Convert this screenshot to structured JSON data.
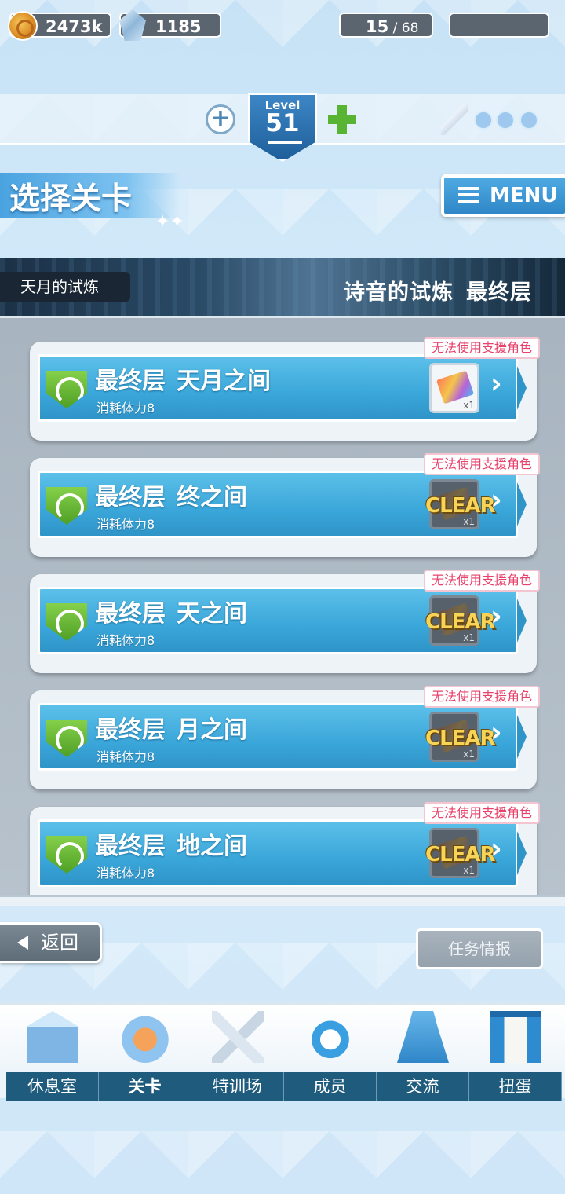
{
  "resources": {
    "coins": "2473k",
    "gems": "1185",
    "level_label": "Level",
    "level": "51",
    "stamina_current": "15",
    "stamina_sep": " / ",
    "stamina_max": "68"
  },
  "header": {
    "title": "选择关卡",
    "menu_label": "MENU"
  },
  "banner": {
    "left": "天月的试炼",
    "right_title": "诗音的试炼",
    "right_sub": "最终层"
  },
  "stages": [
    {
      "floor": "最终层",
      "name": "天月之间",
      "cost": "消耗体力8",
      "tag": "无法使用支援角色",
      "qty": "x1",
      "cleared": false
    },
    {
      "floor": "最终层",
      "name": "终之间",
      "cost": "消耗体力8",
      "tag": "无法使用支援角色",
      "qty": "x1",
      "cleared": true,
      "clear_label": "CLEAR"
    },
    {
      "floor": "最终层",
      "name": "天之间",
      "cost": "消耗体力8",
      "tag": "无法使用支援角色",
      "qty": "x1",
      "cleared": true,
      "clear_label": "CLEAR"
    },
    {
      "floor": "最终层",
      "name": "月之间",
      "cost": "消耗体力8",
      "tag": "无法使用支援角色",
      "qty": "x1",
      "cleared": true,
      "clear_label": "CLEAR"
    },
    {
      "floor": "最终层",
      "name": "地之间",
      "cost": "消耗体力8",
      "tag": "无法使用支援角色",
      "qty": "x1",
      "cleared": true,
      "clear_label": "CLEAR"
    }
  ],
  "footer": {
    "back_label": "返回",
    "mission_label": "任务情报"
  },
  "nav": [
    {
      "label": "休息室",
      "icon": "school-icon"
    },
    {
      "label": "关卡",
      "icon": "dragon-icon",
      "active": true
    },
    {
      "label": "特训场",
      "icon": "crossed-swords-icon"
    },
    {
      "label": "成员",
      "icon": "mascot-face-icon"
    },
    {
      "label": "交流",
      "icon": "dress-icon"
    },
    {
      "label": "扭蛋",
      "icon": "curtain-icon"
    }
  ]
}
